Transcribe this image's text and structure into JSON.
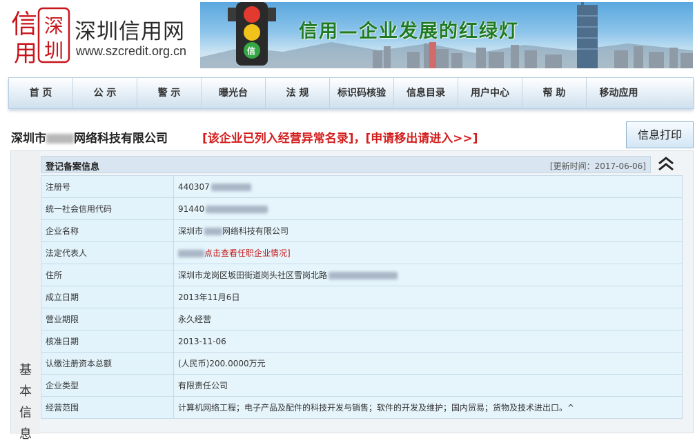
{
  "header": {
    "seal_chars": [
      "信",
      "深",
      "用",
      "圳"
    ],
    "site_name": "深圳信用网",
    "site_url": "www.szcredit.org.cn",
    "banner_slogan": "信用—企业发展的红绿灯",
    "traffic_light_badge": "信"
  },
  "nav": {
    "items": [
      "首 页",
      "公 示",
      "警 示",
      "曝光台",
      "法 规",
      "标识码核验",
      "信息目录",
      "用户中心",
      "帮 助",
      "移动应用"
    ]
  },
  "company": {
    "name_prefix": "深圳市",
    "name_suffix": "网络科技有限公司",
    "abnormal_notice": "[该企业已列入经营异常名录]，[申请移出请进入>>]",
    "print_label": "信息打印"
  },
  "section": {
    "side_label": "基本信息",
    "title": "登记备案信息",
    "update_time": "[更新时间：2017-06-06]",
    "rows": [
      {
        "key": "注册号",
        "value": "440307"
      },
      {
        "key": "统一社会信用代码",
        "value": "91440"
      },
      {
        "key": "企业名称",
        "value": "深圳市",
        "value_suffix": "网络科技有限公司"
      },
      {
        "key": "法定代表人",
        "value": "点击查看任职企业情况]"
      },
      {
        "key": "住所",
        "value": "深圳市龙岗区坂田街道岗头社区雪岗北路"
      },
      {
        "key": "成立日期",
        "value": "2013年11月6日"
      },
      {
        "key": "营业期限",
        "value": "永久经营"
      },
      {
        "key": "核准日期",
        "value": "2013-11-06"
      },
      {
        "key": "认缴注册资本总额",
        "value": "(人民币)200.0000万元"
      },
      {
        "key": "企业类型",
        "value": "有限责任公司"
      },
      {
        "key": "经营范围",
        "value": "计算机网络工程；电子产品及配件的科技开发与销售；软件的开发及维护；国内贸易；货物及技术进出口。^"
      }
    ]
  },
  "colors": {
    "seal_red": "#c8161d",
    "slogan_green": "#1f7a24",
    "notice_red": "#d41e1e",
    "table_bg": "#e6f5fc"
  }
}
